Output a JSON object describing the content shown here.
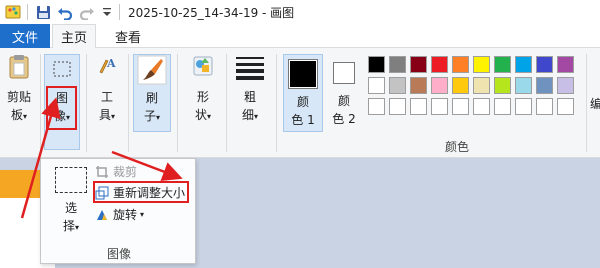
{
  "window": {
    "title": "2025-10-25_14-34-19 - 画图"
  },
  "quick_access": {
    "icons": [
      "paint-app-icon",
      "save-icon",
      "undo-icon",
      "redo-icon",
      "customize-dropdown-icon"
    ]
  },
  "tabs": {
    "file": "文件",
    "home": "主页",
    "view": "查看"
  },
  "ribbon": {
    "clipboard": {
      "label_line1": "剪贴",
      "label_line2": "板",
      "arrow": "▾"
    },
    "image": {
      "label_line1": "图",
      "label_line2": "像",
      "arrow": "▾"
    },
    "tools": {
      "label_line1": "工",
      "label_line2": "具",
      "arrow": "▾"
    },
    "brushes": {
      "label_line1": "刷",
      "label_line2": "子",
      "arrow": "▾"
    },
    "shapes": {
      "label_line1": "形",
      "label_line2": "状",
      "arrow": "▾"
    },
    "size": {
      "label_line1": "粗",
      "label_line2": "细",
      "arrow": "▾"
    },
    "color1": {
      "label_line1": "颜",
      "label_line2": "色 1",
      "value": "#000000"
    },
    "color2": {
      "label_line1": "颜",
      "label_line2": "色 2",
      "value": "#ffffff"
    },
    "colors_caption": "颜色",
    "edit_colors_partial": "编"
  },
  "palette": {
    "row1": [
      "#000000",
      "#7f7f7f",
      "#880015",
      "#ed1c24",
      "#ff7f27",
      "#fff200",
      "#22b14c",
      "#00a2e8",
      "#3f48cc",
      "#a349a4"
    ],
    "row2": [
      "#ffffff",
      "#c3c3c3",
      "#b97a57",
      "#ffaec9",
      "#ffc90e",
      "#efe4b0",
      "#b5e61d",
      "#99d9ea",
      "#7092be",
      "#c8bfe7"
    ]
  },
  "image_dropdown": {
    "select_line1": "选",
    "select_line2": "择",
    "select_arrow": "▾",
    "crop": "裁剪",
    "resize": "重新调整大小",
    "rotate": "旋转",
    "rotate_arrow": "▾",
    "caption": "图像"
  },
  "colors": {
    "accent": "#1e6fcc",
    "highlight_red": "#e02020",
    "canvas_background": "#c9d3e3",
    "ribbon_background": "#f5f6f7"
  }
}
